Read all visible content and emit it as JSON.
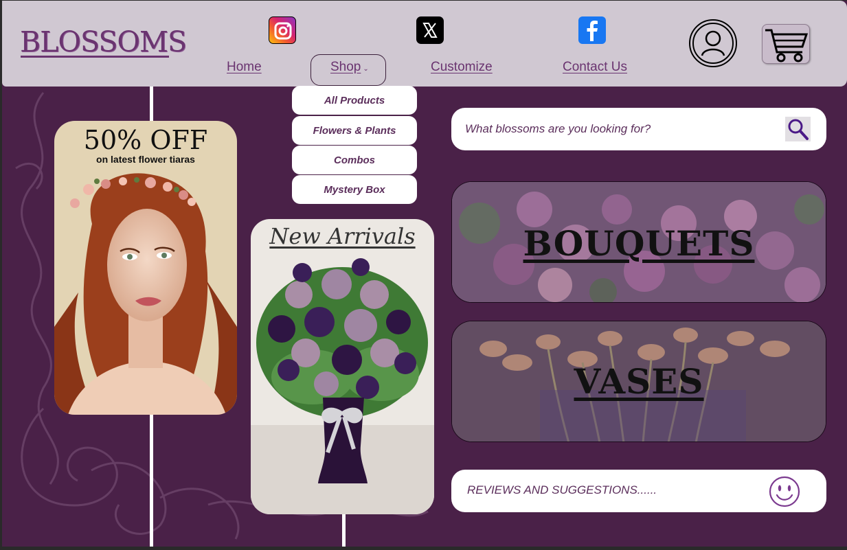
{
  "header": {
    "logo": "BLOSSOMS",
    "nav": [
      {
        "label": "Home"
      },
      {
        "label": "Shop"
      },
      {
        "label": "Customize"
      },
      {
        "label": "Contact Us"
      }
    ],
    "shop_caret": "⌄"
  },
  "shop_menu": {
    "items": [
      "All Products",
      "Flowers & Plants",
      "Combos",
      "Mystery Box"
    ]
  },
  "promo": {
    "title": "50% OFF",
    "subtitle": "on latest flower tiaras"
  },
  "new_arrivals": {
    "title": "New Arrivals"
  },
  "search": {
    "placeholder": "What blossoms are you looking for?"
  },
  "categories": [
    {
      "label": "BOUQUETS"
    },
    {
      "label": "VASES"
    }
  ],
  "reviews": {
    "label": "REVIEWS AND SUGGESTIONS......"
  },
  "icons": {
    "social": [
      "instagram-icon",
      "x-icon",
      "facebook-icon"
    ],
    "account": "user-icon",
    "cart": "cart-icon",
    "search": "search-icon",
    "feedback": "smiley-icon"
  },
  "colors": {
    "header_bg": "#d0c8d2",
    "page_bg": "#4a2148",
    "brand_purple": "#6a3470",
    "text_purple": "#5b2e5b"
  }
}
